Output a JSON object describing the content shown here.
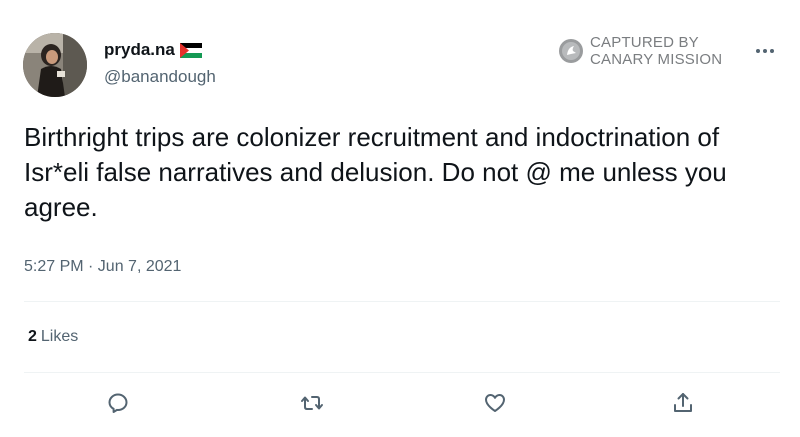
{
  "tweet": {
    "display_name": "pryda.na",
    "flag_icon": "palestine-flag-icon",
    "handle": "@banandough",
    "text": "Birthright trips are colonizer recruitment and indoctrination of Isr*eli false narratives and delusion. Do not @ me unless you agree.",
    "timestamp": "5:27 PM · Jun 7, 2021",
    "likes_count": "2",
    "likes_label": "Likes"
  },
  "watermark": {
    "line1": "CAPTURED BY",
    "line2": "CANARY MISSION",
    "icon": "canary-mission-logo-icon"
  },
  "actions": [
    "reply-icon",
    "retweet-icon",
    "like-icon",
    "share-icon"
  ],
  "colors": {
    "text": "#0f1419",
    "secondary": "#536471",
    "divider": "#eff3f4",
    "watermark": "#7a7d80"
  }
}
